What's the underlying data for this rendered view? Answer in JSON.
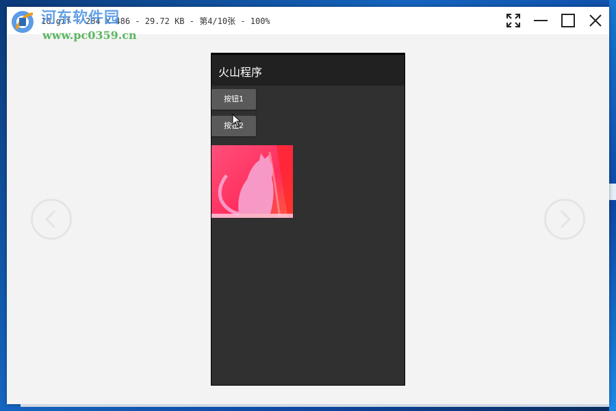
{
  "window": {
    "title": "10.gif - 284 X 486 - 29.72 KB - 第4/10张 - 100%"
  },
  "watermark": {
    "name": "河东软件园",
    "url": "www.pc0359.cn"
  },
  "controls": {
    "fullscreen_icon": "fullscreen-icon",
    "minimize_icon": "minimize-icon",
    "maximize_icon": "maximize-icon",
    "close_icon": "close-icon",
    "prev_icon": "chevron-left-icon",
    "next_icon": "chevron-right-icon"
  },
  "app": {
    "title": "火山程序",
    "button1_label": "按钮1",
    "button2_label": "按钮2",
    "image_icon": "cat-picture"
  },
  "colors": {
    "viewer_background": "#f3f3f3",
    "phone_background": "#303030",
    "action_bar": "#212121",
    "button": "#5a5a5a",
    "image_red": "#ff2a55"
  }
}
